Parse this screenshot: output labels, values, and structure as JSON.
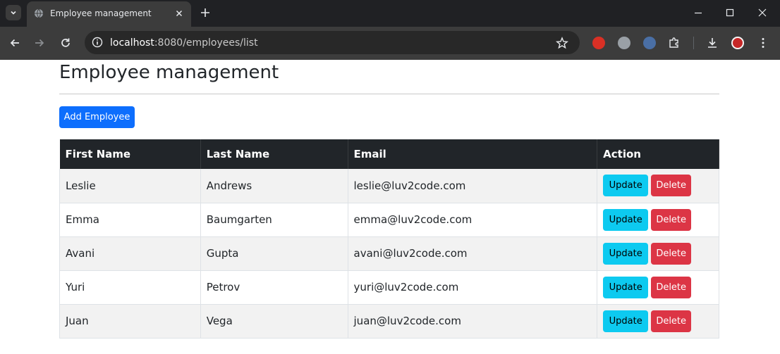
{
  "browser": {
    "tab_title": "Employee management",
    "url_host": "localhost",
    "url_rest": ":8080/employees/list"
  },
  "page": {
    "title": "Employee management",
    "add_button_label": "Add Employee"
  },
  "table": {
    "headers": [
      "First Name",
      "Last Name",
      "Email",
      "Action"
    ],
    "rows": [
      {
        "first_name": "Leslie",
        "last_name": "Andrews",
        "email": "leslie@luv2code.com"
      },
      {
        "first_name": "Emma",
        "last_name": "Baumgarten",
        "email": "emma@luv2code.com"
      },
      {
        "first_name": "Avani",
        "last_name": "Gupta",
        "email": "avani@luv2code.com"
      },
      {
        "first_name": "Yuri",
        "last_name": "Petrov",
        "email": "yuri@luv2code.com"
      },
      {
        "first_name": "Juan",
        "last_name": "Vega",
        "email": "juan@luv2code.com"
      }
    ],
    "update_label": "Update",
    "delete_label": "Delete"
  },
  "colors": {
    "primary": "#0d6efd",
    "info": "#0dcaf0",
    "danger": "#dc3545",
    "table_header": "#212529"
  }
}
